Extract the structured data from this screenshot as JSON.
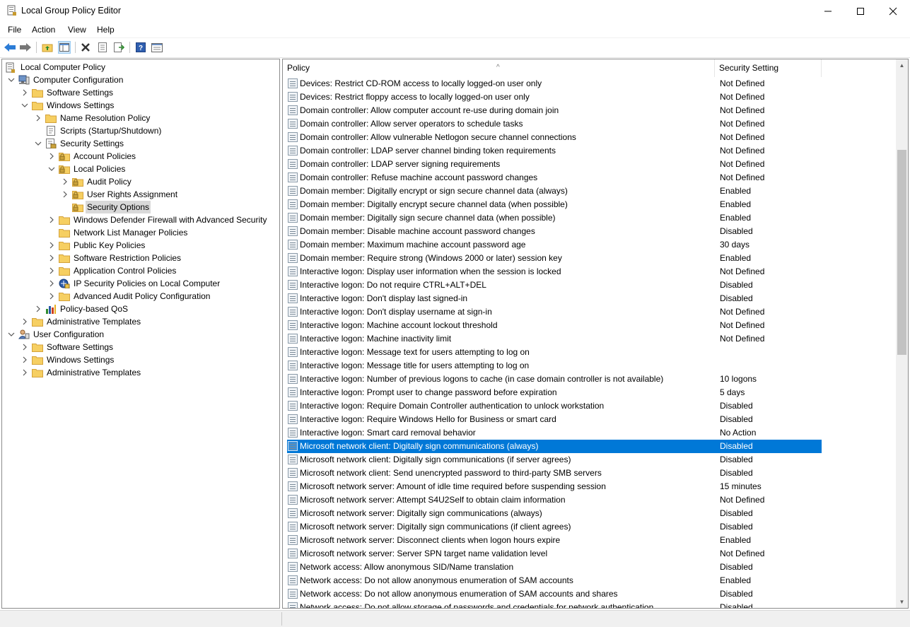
{
  "window": {
    "title": "Local Group Policy Editor",
    "minimize": "minimize",
    "maximize": "maximize",
    "close": "close"
  },
  "menu": [
    "File",
    "Action",
    "View",
    "Help"
  ],
  "toolbar": [
    "back-icon",
    "forward-icon",
    "up-folder-icon",
    "show-hide-tree-icon",
    "delete-icon",
    "properties-icon",
    "export-list-icon",
    "help-icon",
    "view-icon"
  ],
  "tree": [
    {
      "label": "Local Computer Policy",
      "level": 0,
      "icon": "computer-policy-icon",
      "expander": ""
    },
    {
      "label": "Computer Configuration",
      "level": 1,
      "icon": "computer-icon",
      "expander": "expanded"
    },
    {
      "label": "Software Settings",
      "level": 2,
      "icon": "folder-icon",
      "expander": "collapsed"
    },
    {
      "label": "Windows Settings",
      "level": 2,
      "icon": "folder-icon",
      "expander": "expanded"
    },
    {
      "label": "Name Resolution Policy",
      "level": 3,
      "icon": "folder-icon",
      "expander": "collapsed"
    },
    {
      "label": "Scripts (Startup/Shutdown)",
      "level": 3,
      "icon": "scripts-icon",
      "expander": ""
    },
    {
      "label": "Security Settings",
      "level": 3,
      "icon": "security-icon",
      "expander": "expanded"
    },
    {
      "label": "Account Policies",
      "level": 4,
      "icon": "folder-lock-icon",
      "expander": "collapsed"
    },
    {
      "label": "Local Policies",
      "level": 4,
      "icon": "folder-lock-icon",
      "expander": "expanded"
    },
    {
      "label": "Audit Policy",
      "level": 5,
      "icon": "folder-lock-icon",
      "expander": "collapsed"
    },
    {
      "label": "User Rights Assignment",
      "level": 5,
      "icon": "folder-lock-icon",
      "expander": "collapsed"
    },
    {
      "label": "Security Options",
      "level": 5,
      "icon": "folder-lock-icon",
      "expander": "",
      "selected": true
    },
    {
      "label": "Windows Defender Firewall with Advanced Security",
      "level": 4,
      "icon": "folder-icon",
      "expander": "collapsed"
    },
    {
      "label": "Network List Manager Policies",
      "level": 4,
      "icon": "folder-icon",
      "expander": ""
    },
    {
      "label": "Public Key Policies",
      "level": 4,
      "icon": "folder-icon",
      "expander": "collapsed"
    },
    {
      "label": "Software Restriction Policies",
      "level": 4,
      "icon": "folder-icon",
      "expander": "collapsed"
    },
    {
      "label": "Application Control Policies",
      "level": 4,
      "icon": "folder-icon",
      "expander": "collapsed"
    },
    {
      "label": "IP Security Policies on Local Computer",
      "level": 4,
      "icon": "ipsec-icon",
      "expander": "collapsed"
    },
    {
      "label": "Advanced Audit Policy Configuration",
      "level": 4,
      "icon": "folder-icon",
      "expander": "collapsed"
    },
    {
      "label": "Policy-based QoS",
      "level": 3,
      "icon": "chart-icon",
      "expander": "collapsed"
    },
    {
      "label": "Administrative Templates",
      "level": 2,
      "icon": "folder-icon",
      "expander": "collapsed"
    },
    {
      "label": "User Configuration",
      "level": 1,
      "icon": "user-icon",
      "expander": "expanded"
    },
    {
      "label": "Software Settings",
      "level": 2,
      "icon": "folder-icon",
      "expander": "collapsed"
    },
    {
      "label": "Windows Settings",
      "level": 2,
      "icon": "folder-icon",
      "expander": "collapsed"
    },
    {
      "label": "Administrative Templates",
      "level": 2,
      "icon": "folder-icon",
      "expander": "collapsed"
    }
  ],
  "list": {
    "columns": {
      "policy": "Policy",
      "setting": "Security Setting"
    },
    "rows": [
      {
        "policy": "Devices: Restrict CD-ROM access to locally logged-on user only",
        "setting": "Not Defined"
      },
      {
        "policy": "Devices: Restrict floppy access to locally logged-on user only",
        "setting": "Not Defined"
      },
      {
        "policy": "Domain controller: Allow computer account re-use during domain join",
        "setting": "Not Defined"
      },
      {
        "policy": "Domain controller: Allow server operators to schedule tasks",
        "setting": "Not Defined"
      },
      {
        "policy": "Domain controller: Allow vulnerable Netlogon secure channel connections",
        "setting": "Not Defined"
      },
      {
        "policy": "Domain controller: LDAP server channel binding token requirements",
        "setting": "Not Defined"
      },
      {
        "policy": "Domain controller: LDAP server signing requirements",
        "setting": "Not Defined"
      },
      {
        "policy": "Domain controller: Refuse machine account password changes",
        "setting": "Not Defined"
      },
      {
        "policy": "Domain member: Digitally encrypt or sign secure channel data (always)",
        "setting": "Enabled"
      },
      {
        "policy": "Domain member: Digitally encrypt secure channel data (when possible)",
        "setting": "Enabled"
      },
      {
        "policy": "Domain member: Digitally sign secure channel data (when possible)",
        "setting": "Enabled"
      },
      {
        "policy": "Domain member: Disable machine account password changes",
        "setting": "Disabled"
      },
      {
        "policy": "Domain member: Maximum machine account password age",
        "setting": "30 days"
      },
      {
        "policy": "Domain member: Require strong (Windows 2000 or later) session key",
        "setting": "Enabled"
      },
      {
        "policy": "Interactive logon: Display user information when the session is locked",
        "setting": "Not Defined"
      },
      {
        "policy": "Interactive logon: Do not require CTRL+ALT+DEL",
        "setting": "Disabled"
      },
      {
        "policy": "Interactive logon: Don't display last signed-in",
        "setting": "Disabled"
      },
      {
        "policy": "Interactive logon: Don't display username at sign-in",
        "setting": "Not Defined"
      },
      {
        "policy": "Interactive logon: Machine account lockout threshold",
        "setting": "Not Defined"
      },
      {
        "policy": "Interactive logon: Machine inactivity limit",
        "setting": "Not Defined"
      },
      {
        "policy": "Interactive logon: Message text for users attempting to log on",
        "setting": ""
      },
      {
        "policy": "Interactive logon: Message title for users attempting to log on",
        "setting": ""
      },
      {
        "policy": "Interactive logon: Number of previous logons to cache (in case domain controller is not available)",
        "setting": "10 logons"
      },
      {
        "policy": "Interactive logon: Prompt user to change password before expiration",
        "setting": "5 days"
      },
      {
        "policy": "Interactive logon: Require Domain Controller authentication to unlock workstation",
        "setting": "Disabled"
      },
      {
        "policy": "Interactive logon: Require Windows Hello for Business or smart card",
        "setting": "Disabled"
      },
      {
        "policy": "Interactive logon: Smart card removal behavior",
        "setting": "No Action"
      },
      {
        "policy": "Microsoft network client: Digitally sign communications (always)",
        "setting": "Disabled",
        "selected": true
      },
      {
        "policy": "Microsoft network client: Digitally sign communications (if server agrees)",
        "setting": "Disabled"
      },
      {
        "policy": "Microsoft network client: Send unencrypted password to third-party SMB servers",
        "setting": "Disabled"
      },
      {
        "policy": "Microsoft network server: Amount of idle time required before suspending session",
        "setting": "15 minutes"
      },
      {
        "policy": "Microsoft network server: Attempt S4U2Self to obtain claim information",
        "setting": "Not Defined"
      },
      {
        "policy": "Microsoft network server: Digitally sign communications (always)",
        "setting": "Disabled"
      },
      {
        "policy": "Microsoft network server: Digitally sign communications (if client agrees)",
        "setting": "Disabled"
      },
      {
        "policy": "Microsoft network server: Disconnect clients when logon hours expire",
        "setting": "Enabled"
      },
      {
        "policy": "Microsoft network server: Server SPN target name validation level",
        "setting": "Not Defined"
      },
      {
        "policy": "Network access: Allow anonymous SID/Name translation",
        "setting": "Disabled"
      },
      {
        "policy": "Network access: Do not allow anonymous enumeration of SAM accounts",
        "setting": "Enabled"
      },
      {
        "policy": "Network access: Do not allow anonymous enumeration of SAM accounts and shares",
        "setting": "Disabled"
      },
      {
        "policy": "Network access: Do not allow storage of passwords and credentials for network authentication",
        "setting": "Disabled"
      }
    ]
  },
  "colors": {
    "selection": "#0078d7",
    "tree_selection": "#d9d9d9"
  }
}
